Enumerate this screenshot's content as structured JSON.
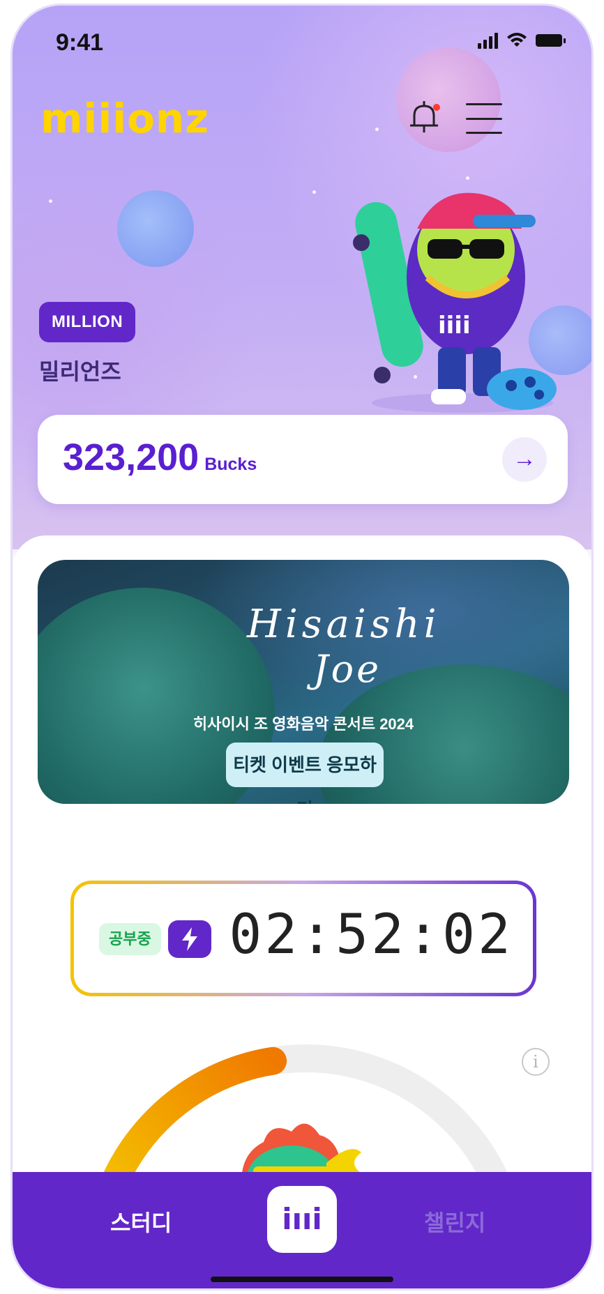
{
  "status_bar": {
    "time": "9:41"
  },
  "header": {
    "logo": "miiionz"
  },
  "profile": {
    "badge": "MILLION",
    "nickname": "밀리언즈"
  },
  "bucks": {
    "amount": "323,200",
    "unit": "Bucks",
    "arrow": "→"
  },
  "banner": {
    "title_line1": "Hisaishi",
    "title_line2": "Joe",
    "subtitle": "히사이시 조 영화음악 콘서트 2024",
    "button": "티켓 이벤트 응모하기"
  },
  "timer": {
    "status": "공부중",
    "value": "02:52:02"
  },
  "progress": {
    "fraction": 0.45
  },
  "tabbar": {
    "study": "스터디",
    "center": "iııi",
    "challenge": "챌린지"
  },
  "colors": {
    "brand_purple": "#6227c9",
    "logo_yellow": "#ffd400",
    "chip_green": "#17a24b"
  },
  "icons": [
    "bell-icon",
    "menu-icon",
    "arrow-right-icon",
    "bolt-icon",
    "info-icon"
  ]
}
